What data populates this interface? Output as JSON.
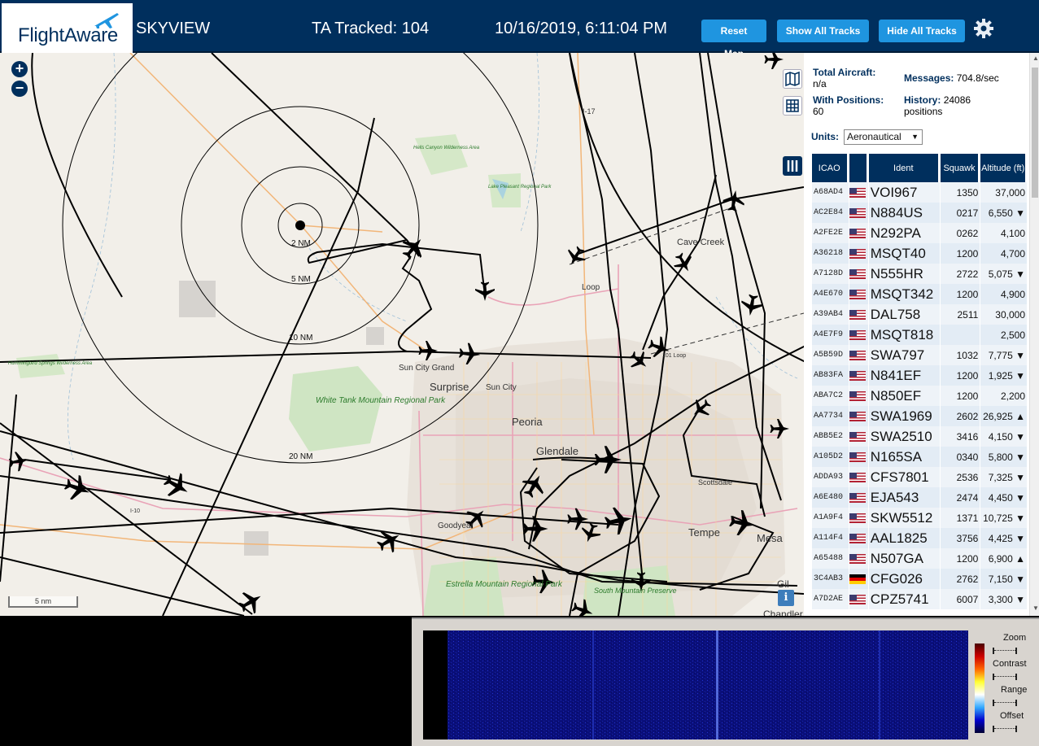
{
  "header": {
    "logo_text": "FlightAware",
    "app_title": "SKYVIEW",
    "tracked": "TA Tracked: 104",
    "datetime": "10/16/2019, 6:11:04 PM",
    "buttons": {
      "reset_map": "Reset Map",
      "show_all_tracks": "Show All Tracks",
      "hide_all_tracks": "Hide All Tracks"
    },
    "settings_icon": "gear-icon"
  },
  "map": {
    "zoom_in": "+",
    "zoom_out": "−",
    "scale_label": "5 nm",
    "info_button": "i",
    "ring_labels": [
      "2 NM",
      "5 NM",
      "10 NM",
      "20 NM"
    ],
    "place_labels": [
      "Cave Creek",
      "Sun City Grand",
      "Surprise",
      "Sun City",
      "Peoria",
      "Glendale",
      "Tempe",
      "Mesa",
      "Scottsdale",
      "Goodyear",
      "101 Loop",
      "I-17",
      "I-10",
      "Gil",
      "Chandler",
      "Loop"
    ],
    "park_labels": [
      "White Tank Mountain Regional Park",
      "Estrella Mountain Regional Park",
      "South Mountain Preserve",
      "Hummingbird Springs Wilderness Area",
      "Lake Pleasant Regional Park",
      "Hells Canyon Wilderness Area"
    ],
    "side_icons": [
      "map-layers-icon",
      "grid-icon",
      "columns-icon"
    ]
  },
  "sidebar": {
    "stats": {
      "total_aircraft_label": "Total Aircraft:",
      "total_aircraft_value": "n/a",
      "messages_label": "Messages:",
      "messages_value": "704.8/sec",
      "with_positions_label": "With Positions:",
      "with_positions_value": "60",
      "history_label": "History:",
      "history_value": "24086 positions"
    },
    "units_label": "Units:",
    "units_value": "Aeronautical",
    "table": {
      "headers": [
        "ICAO",
        "",
        "Ident",
        "Squawk",
        "Altitude (ft)"
      ],
      "rows": [
        {
          "icao": "A68AD4",
          "flag": "us",
          "ident": "VOI967",
          "squawk": "1350",
          "alt": "37,000"
        },
        {
          "icao": "AC2E84",
          "flag": "us",
          "ident": "N884US",
          "squawk": "0217",
          "alt": "6,550 ▼"
        },
        {
          "icao": "A2FE2E",
          "flag": "us",
          "ident": "N292PA",
          "squawk": "0262",
          "alt": "4,100"
        },
        {
          "icao": "A36218",
          "flag": "us",
          "ident": "MSQT40",
          "squawk": "1200",
          "alt": "4,700"
        },
        {
          "icao": "A7128D",
          "flag": "us",
          "ident": "N555HR",
          "squawk": "2722",
          "alt": "5,075 ▼"
        },
        {
          "icao": "A4E670",
          "flag": "us",
          "ident": "MSQT342",
          "squawk": "1200",
          "alt": "4,900"
        },
        {
          "icao": "A39AB4",
          "flag": "us",
          "ident": "DAL758",
          "squawk": "2511",
          "alt": "30,000"
        },
        {
          "icao": "A4E7F9",
          "flag": "us",
          "ident": "MSQT818",
          "squawk": "",
          "alt": "2,500"
        },
        {
          "icao": "A5B59D",
          "flag": "us",
          "ident": "SWA797",
          "squawk": "1032",
          "alt": "7,775 ▼"
        },
        {
          "icao": "AB83FA",
          "flag": "us",
          "ident": "N841EF",
          "squawk": "1200",
          "alt": "1,925 ▼"
        },
        {
          "icao": "ABA7C2",
          "flag": "us",
          "ident": "N850EF",
          "squawk": "1200",
          "alt": "2,200"
        },
        {
          "icao": "AA7734",
          "flag": "us",
          "ident": "SWA1969",
          "squawk": "2602",
          "alt": "26,925 ▲"
        },
        {
          "icao": "ABB5E2",
          "flag": "us",
          "ident": "SWA2510",
          "squawk": "3416",
          "alt": "4,150 ▼"
        },
        {
          "icao": "A105D2",
          "flag": "us",
          "ident": "N165SA",
          "squawk": "0340",
          "alt": "5,800 ▼"
        },
        {
          "icao": "ADDA93",
          "flag": "us",
          "ident": "CFS7801",
          "squawk": "2536",
          "alt": "7,325 ▼"
        },
        {
          "icao": "A6E480",
          "flag": "us",
          "ident": "EJA543",
          "squawk": "2474",
          "alt": "4,450 ▼"
        },
        {
          "icao": "A1A9F4",
          "flag": "us",
          "ident": "SKW5512",
          "squawk": "1371",
          "alt": "10,725 ▼"
        },
        {
          "icao": "A114F4",
          "flag": "us",
          "ident": "AAL1825",
          "squawk": "3756",
          "alt": "4,425 ▼"
        },
        {
          "icao": "A65488",
          "flag": "us",
          "ident": "N507GA",
          "squawk": "1200",
          "alt": "6,900 ▲"
        },
        {
          "icao": "3C4AB3",
          "flag": "de",
          "ident": "CFG026",
          "squawk": "2762",
          "alt": "7,150 ▼"
        },
        {
          "icao": "A7D2AE",
          "flag": "us",
          "ident": "CPZ5741",
          "squawk": "6007",
          "alt": "3,300 ▼"
        }
      ]
    }
  },
  "spectrum": {
    "controls": [
      "Zoom",
      "Contrast",
      "Range",
      "Offset"
    ]
  }
}
